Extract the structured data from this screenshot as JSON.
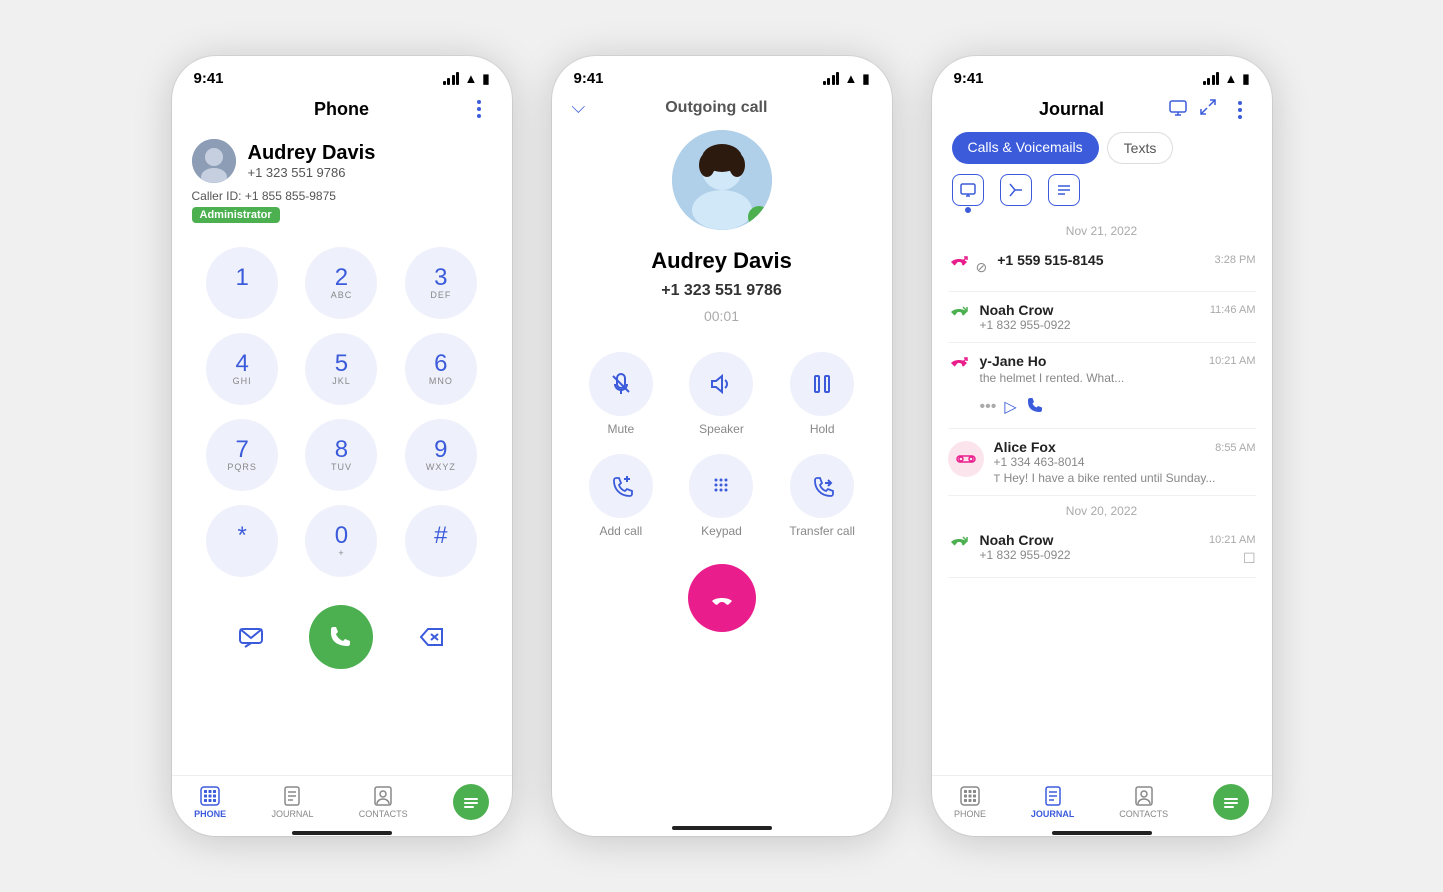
{
  "screen1": {
    "status_time": "9:41",
    "title": "Phone",
    "contact_name": "Audrey Davis",
    "contact_phone": "+1 323 551 9786",
    "caller_id": "Caller ID: +1 855 855-9875",
    "badge": "Administrator",
    "dialpad": [
      {
        "num": "1",
        "sub": ""
      },
      {
        "num": "2",
        "sub": "ABC"
      },
      {
        "num": "3",
        "sub": "DEF"
      },
      {
        "num": "4",
        "sub": "GHI"
      },
      {
        "num": "5",
        "sub": "JKL"
      },
      {
        "num": "6",
        "sub": "MNO"
      },
      {
        "num": "7",
        "sub": "PQRS"
      },
      {
        "num": "8",
        "sub": "TUV"
      },
      {
        "num": "9",
        "sub": "WXYZ"
      },
      {
        "num": "*",
        "sub": ""
      },
      {
        "num": "0",
        "sub": "+"
      },
      {
        "num": "#",
        "sub": ""
      }
    ],
    "nav": [
      {
        "label": "PHONE",
        "active": true
      },
      {
        "label": "JOURNAL",
        "active": false
      },
      {
        "label": "CONTACTS",
        "active": false
      }
    ]
  },
  "screen2": {
    "status_time": "9:41",
    "header": "Outgoing call",
    "caller_name": "Audrey Davis",
    "caller_number": "+1 323 551 9786",
    "timer": "00:01",
    "controls": [
      {
        "label": "Mute",
        "icon": "🎤"
      },
      {
        "label": "Speaker",
        "icon": "🔊"
      },
      {
        "label": "Hold",
        "icon": "⏸"
      },
      {
        "label": "Add call",
        "icon": "➕"
      },
      {
        "label": "Keypad",
        "icon": "⌨"
      },
      {
        "label": "Transfer call",
        "icon": "➡"
      }
    ]
  },
  "screen3": {
    "status_time": "9:41",
    "title": "Journal",
    "tabs": [
      "Calls & Voicemails",
      "Texts"
    ],
    "active_tab": 0,
    "date1": "Nov 21, 2022",
    "date2": "Nov 20, 2022",
    "entries": [
      {
        "type": "missed",
        "name": "",
        "number": "+1 559 515-8145",
        "time": "3:28 PM",
        "snippet": ""
      },
      {
        "type": "outgoing",
        "name": "Noah Crow",
        "number": "+1 832 955-0922",
        "time": "11:46 AM",
        "snippet": ""
      },
      {
        "type": "voicemail",
        "name": "y-Jane Ho",
        "number": "",
        "time": "10:21 AM",
        "snippet": "the helmet I rented. What..."
      },
      {
        "type": "voicemail",
        "name": "Alice Fox",
        "number": "+1 334 463-8014",
        "time": "8:55 AM",
        "snippet": "Hey! I have a bike rented until Sunday..."
      },
      {
        "type": "outgoing",
        "name": "Noah Crow",
        "number": "+1 832 955-0922",
        "time": "10:21 AM",
        "snippet": ""
      }
    ],
    "nav": [
      {
        "label": "PHONE",
        "active": false
      },
      {
        "label": "JOURNAL",
        "active": true
      },
      {
        "label": "CONTACTS",
        "active": false
      }
    ]
  }
}
